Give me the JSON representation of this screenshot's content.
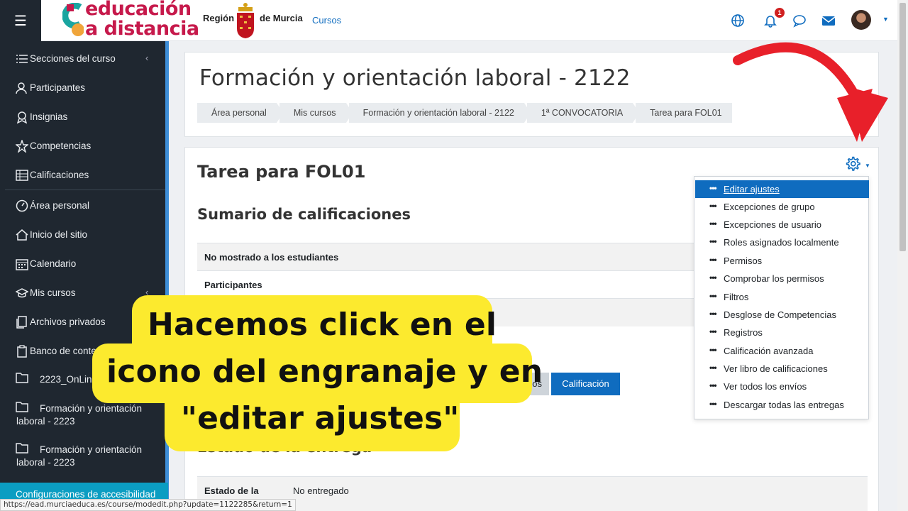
{
  "topbar": {
    "logo_line1": "educación",
    "logo_line2": "a distancia",
    "region_left": "Región",
    "region_right": "de Murcia",
    "cursos_link": "Cursos",
    "notification_count": "1"
  },
  "sidebar": {
    "items": [
      {
        "label": "Secciones del curso",
        "icon": "list-icon"
      },
      {
        "label": "Participantes",
        "icon": "users-icon"
      },
      {
        "label": "Insignias",
        "icon": "badge-icon"
      },
      {
        "label": "Competencias",
        "icon": "star-icon"
      },
      {
        "label": "Calificaciones",
        "icon": "table-icon"
      },
      {
        "label": "Área personal",
        "icon": "dashboard-icon"
      },
      {
        "label": "Inicio del sitio",
        "icon": "home-icon"
      },
      {
        "label": "Calendario",
        "icon": "calendar-icon"
      },
      {
        "label": "Mis cursos",
        "icon": "graduation-cap-icon"
      },
      {
        "label": "Archivos privados",
        "icon": "files-icon"
      },
      {
        "label": "Banco de contenido",
        "icon": "clipboard-icon"
      }
    ],
    "folders": [
      {
        "line1": "2223_OnLine",
        "line2": ""
      },
      {
        "line1": "Formación y orientación",
        "line2": "laboral - 2223"
      },
      {
        "line1": "Formación y orientación",
        "line2": "laboral - 2223"
      }
    ],
    "accessibility": "Configuraciones de accesibilidad"
  },
  "header": {
    "course_title": "Formación y orientación laboral - 2122",
    "breadcrumb": [
      "Área personal",
      "Mis cursos",
      "Formación y orientación laboral - 2122",
      "1ª CONVOCATORIA",
      "Tarea para FOL01"
    ]
  },
  "main": {
    "page_title": "Tarea para FOL01",
    "summary_title": "Sumario de calificaciones",
    "summary_rows": [
      "No mostrado a los estudiantes",
      "Participantes"
    ],
    "btn_envios": "os",
    "btn_calificacion": "Calificación",
    "estado_title": "Estado de la entrega",
    "estado_key": "Estado de la",
    "estado_value": "No entregado"
  },
  "menu": {
    "items": [
      "Editar ajustes",
      "Excepciones de grupo",
      "Excepciones de usuario",
      "Roles asignados localmente",
      "Permisos",
      "Comprobar los permisos",
      "Filtros",
      "Desglose de Competencias",
      "Registros",
      "Calificación avanzada",
      "Ver libro de calificaciones",
      "Ver todos los envíos",
      "Descargar todas las entregas"
    ],
    "active_index": 0
  },
  "callout": {
    "line1": "Hacemos click en el",
    "line2": "icono del engranaje y en",
    "line3": "\"editar ajustes\""
  },
  "status_url": "https://ead.murciaeduca.es/course/modedit.php?update=1122285&return=1",
  "colors": {
    "primary": "#0f6cbf",
    "sidebar_bg": "#1f2730",
    "callout_bg": "#fcea2e",
    "arrow": "#e8202a",
    "logo": "#c6194b"
  }
}
